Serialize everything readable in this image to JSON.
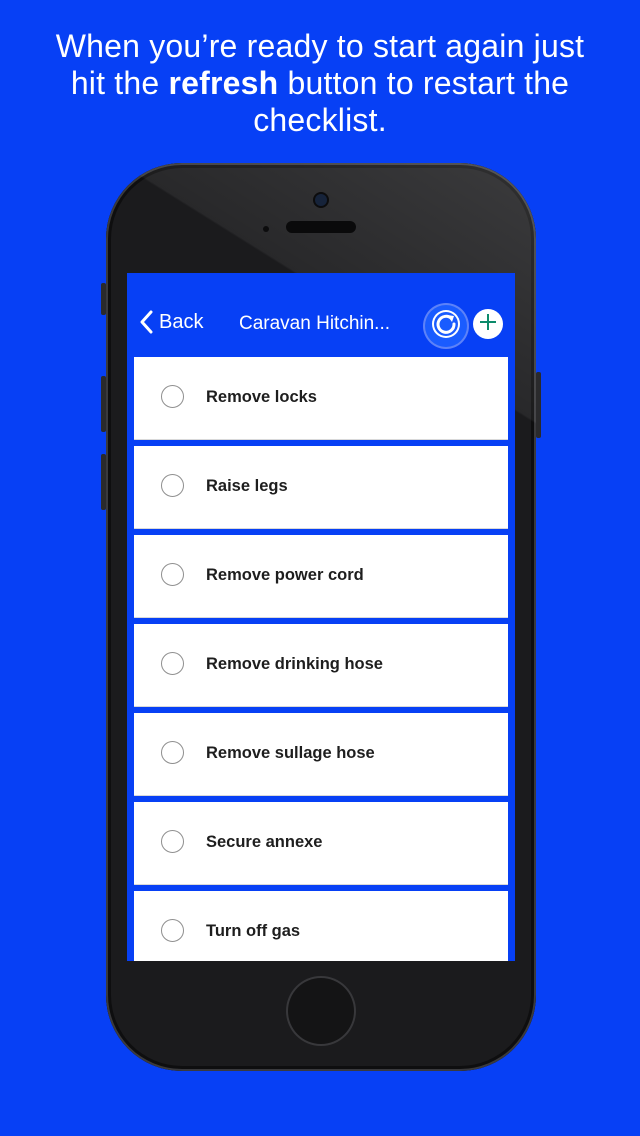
{
  "caption": {
    "before": "When you’re ready to start again just hit the",
    "bold": "refresh",
    "after": "button to restart the checklist."
  },
  "navbar": {
    "back_label": "Back",
    "title": "Caravan Hitchin...",
    "refresh_icon": "refresh-icon",
    "add_icon": "plus-icon"
  },
  "checklist": {
    "items": [
      {
        "label": "Remove locks",
        "checked": false
      },
      {
        "label": "Raise legs",
        "checked": false
      },
      {
        "label": "Remove power cord",
        "checked": false
      },
      {
        "label": "Remove drinking hose",
        "checked": false
      },
      {
        "label": "Remove sullage hose",
        "checked": false
      },
      {
        "label": "Secure annexe",
        "checked": false
      },
      {
        "label": "Turn off gas",
        "checked": false
      }
    ]
  },
  "colors": {
    "background": "#0740f5",
    "accent": "#1a5cff",
    "phone": "#1b1b1d"
  }
}
